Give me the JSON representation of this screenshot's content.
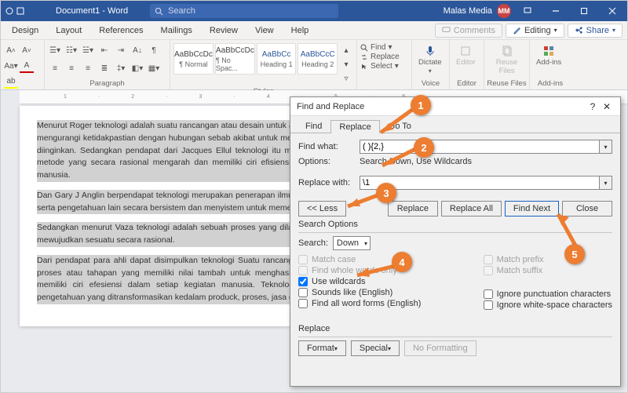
{
  "title_doc": "Document1 - Word",
  "search_placeholder": "Search",
  "user_name": "Malas Media",
  "user_initials": "MM",
  "ribbon_tabs": [
    "Design",
    "Layout",
    "References",
    "Mailings",
    "Review",
    "View",
    "Help"
  ],
  "right_pills": {
    "comments": "Comments",
    "editing": "Editing",
    "share": "Share"
  },
  "groups": {
    "paragraph": "Paragraph",
    "styles": "Styles",
    "editing_col": {
      "find": "Find",
      "replace": "Replace",
      "select": "Select"
    },
    "voice": "Voice",
    "voice_btn": "Dictate",
    "editor": "Editor",
    "editor_btn": "Editor",
    "reuse": "Reuse Files",
    "reuse_btn": "Reuse Files",
    "addins": "Add-ins",
    "addins_btn": "Add-ins"
  },
  "style_boxes": [
    {
      "sample": "AaBbCcDc",
      "name": "¶ Normal"
    },
    {
      "sample": "AaBbCcDc",
      "name": "¶ No Spac..."
    },
    {
      "sample": "AaBbCc",
      "name": "Heading 1"
    },
    {
      "sample": "AaBbCcC",
      "name": "Heading 2"
    }
  ],
  "doc_paras": [
    "Menurut Roger teknologi adalah suatu      rancangan atau desain untuk alat bantu tindakan yang mengurangi ketidakpastian dengan hubungan sebab akibat untuk mencapai suatu hasil yang diinginkan. Sedangkan pendapat dari    Jacques Ellul teknologi itu merupakaan keseluruhan metode yang secara rasional mengarah dan memiliki ciri efisiensi dalam setiap kegiatan manusia.",
    "Dan Gary J Anglin berpendapat teknologi merupakan penerapan ilmu-ilmu perilaku dan alam serta pengetahuan lain secara bersistem dan      menyistem untuk memecahkan masalah.",
    "Sedangkan menurut Vaza teknologi adalah sebuah proses yang dilaksanakan dalam upaya mewujudkan sesuatu secara rasional.",
    "Dari pendapat para ahli dapat disimpulkan teknologi Suatu rancangan atau desain melalui proses atau tahapan yang memiliki nilai tambah untuk menghasilkan suatu produk dan memiliki ciri efesiensi dalam setiap kegiatan manusia. Teknologi bisa dikatakan ilmu pengetahuan yang ditransformasikan kedalam produck, proses, jasa dan struktur praktis."
  ],
  "dialog": {
    "title": "Find and Replace",
    "tabs": [
      "Find",
      "Replace",
      "Go To"
    ],
    "active_tab": 1,
    "find_label": "Find what:",
    "find_value": "( ){2,}",
    "options_label": "Options:",
    "options_value": "Search Down, Use Wildcards",
    "replace_label": "Replace with:",
    "replace_value": "\\1",
    "less": "<< Less",
    "btn_replace": "Replace",
    "btn_replace_all": "Replace All",
    "btn_find_next": "Find Next",
    "btn_close": "Close",
    "search_options": "Search Options",
    "search_label": "Search:",
    "search_direction": "Down",
    "cb_match_case": "Match case",
    "cb_whole_words": "Find whole words only",
    "cb_wildcards": "Use wildcards",
    "cb_sounds": "Sounds like (English)",
    "cb_word_forms": "Find all word forms (English)",
    "cb_prefix": "Match prefix",
    "cb_suffix": "Match suffix",
    "cb_punct": "Ignore punctuation characters",
    "cb_space": "Ignore white-space characters",
    "replace_section": "Replace",
    "btn_format": "Format",
    "btn_special": "Special",
    "btn_noformat": "No Formatting"
  },
  "callouts": [
    "1",
    "2",
    "3",
    "4",
    "5"
  ]
}
